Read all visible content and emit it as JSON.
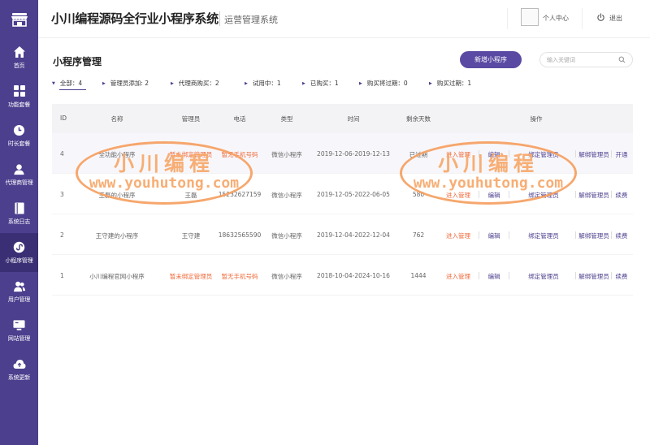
{
  "brand": {
    "title": "小川编程源码全行业小程序系统",
    "subtitle": "运营管理系统"
  },
  "header": {
    "user_center": "个人中心",
    "logout": "退出"
  },
  "sidebar": {
    "items": [
      {
        "label": "首页",
        "icon": "home-icon"
      },
      {
        "label": "功能套餐",
        "icon": "grid-icon"
      },
      {
        "label": "时长套餐",
        "icon": "clock-icon"
      },
      {
        "label": "代理商管理",
        "icon": "person-icon"
      },
      {
        "label": "系统日志",
        "icon": "book-icon"
      },
      {
        "label": "小程序管理",
        "icon": "miniprogram-icon"
      },
      {
        "label": "用户管理",
        "icon": "users-icon"
      },
      {
        "label": "网站管理",
        "icon": "monitor-icon"
      },
      {
        "label": "系统更新",
        "icon": "cloud-icon"
      }
    ],
    "active_index": 5
  },
  "page": {
    "title": "小程序管理",
    "new_button": "新增小程序",
    "search_placeholder": "输入关键词"
  },
  "filters": [
    "全部：4",
    "管理员添加: 2",
    "代理商购买：2",
    "试用中：1",
    "已购买：1",
    "购买将过期：0",
    "购买过期：1"
  ],
  "table": {
    "headers": [
      "ID",
      "名称",
      "管理员",
      "电话",
      "类型",
      "时间",
      "剩余天数",
      "操作"
    ],
    "rows": [
      {
        "id": "4",
        "name": "全功能小程序",
        "admin": "暂未绑定管理员",
        "phone": "暂无手机号码",
        "type": "微信小程序",
        "time": "2019-12-06-2019-12-13",
        "days": "已过期",
        "ops": [
          "进入管理",
          "编辑",
          "绑定管理员",
          "解绑管理员",
          "开通"
        ]
      },
      {
        "id": "3",
        "name": "王磊的小程序",
        "admin": "王磊",
        "phone": "15232627159",
        "type": "微信小程序",
        "time": "2019-12-05-2022-06-05",
        "days": "580",
        "ops": [
          "进入管理",
          "编辑",
          "绑定管理员",
          "解绑管理员",
          "续费"
        ]
      },
      {
        "id": "2",
        "name": "王守建的小程序",
        "admin": "王守建",
        "phone": "18632565590",
        "type": "微信小程序",
        "time": "2019-12-04-2022-12-04",
        "days": "762",
        "ops": [
          "进入管理",
          "编辑",
          "绑定管理员",
          "解绑管理员",
          "续费"
        ]
      },
      {
        "id": "1",
        "name": "小川编程官网小程序",
        "admin": "暂未绑定管理员",
        "phone": "暂无手机号码",
        "type": "微信小程序",
        "time": "2018-10-04-2024-10-16",
        "days": "1444",
        "ops": [
          "进入管理",
          "编辑",
          "绑定管理员",
          "解绑管理员",
          "续费"
        ]
      }
    ]
  },
  "watermark": {
    "line1": "小川编程",
    "line2": "www.youhutong.com"
  },
  "colors": {
    "sidebar": "#4c3f8e",
    "accent": "#5a4aa3",
    "warning": "#f06a3a",
    "watermark": "#f6a061"
  }
}
